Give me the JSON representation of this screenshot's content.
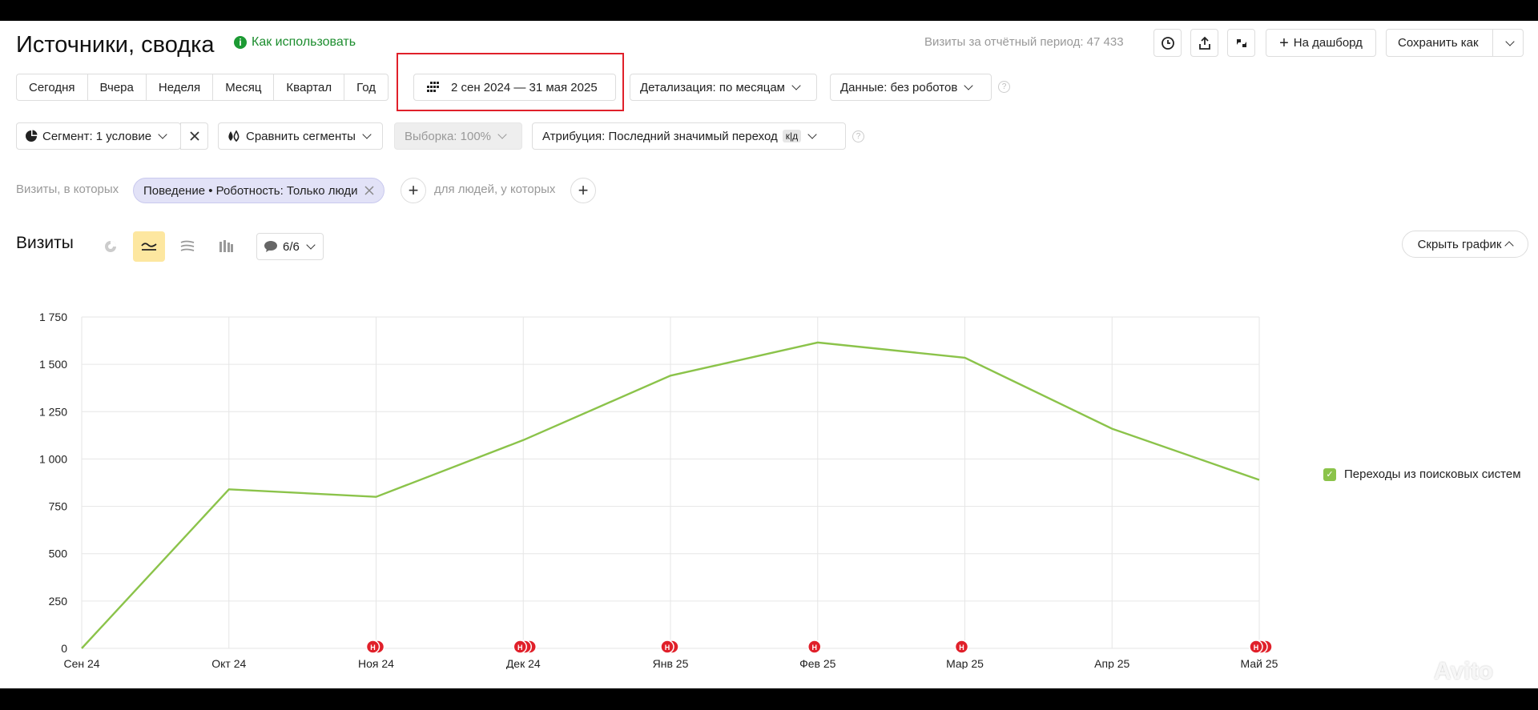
{
  "header": {
    "title": "Источники, сводка",
    "howto_label": "Как использовать",
    "visits_period": "Визиты за отчётный период: 47 433",
    "dashboard_label": "На дашборд",
    "save_as_label": "Сохранить как"
  },
  "period_buttons": [
    "Сегодня",
    "Вчера",
    "Неделя",
    "Месяц",
    "Квартал",
    "Год"
  ],
  "date_range": "2 сен 2024 — 31 мая 2025",
  "detail_label": "Детализация: по месяцам",
  "data_label": "Данные: без роботов",
  "segment_label": "Сегмент: 1 условие",
  "compare_label": "Сравнить сегменты",
  "sample_label": "Выборка: 100%",
  "attribution_label": "Атрибуция: Последний значимый переход",
  "attribution_badge": "к|д",
  "filters": {
    "visits_label": "Визиты, в которых",
    "chip_label": "Поведение • Роботность: Только люди",
    "people_label": "для людей, у которых"
  },
  "chart_section": {
    "title": "Визиты",
    "series_count": "6/6",
    "hide_label": "Скрыть график"
  },
  "legend_label": "Переходы из поисковых систем",
  "watermark": "Avito",
  "colors": {
    "line": "#8bc34a",
    "marker": "#e0202a",
    "highlight": "#e0202a"
  },
  "chart_data": {
    "type": "line",
    "categories": [
      "Сен 24",
      "Окт 24",
      "Ноя 24",
      "Дек 24",
      "Янв 25",
      "Фев 25",
      "Мар 25",
      "Апр 25",
      "Май 25"
    ],
    "series": [
      {
        "name": "Переходы из поисковых систем",
        "values": [
          0,
          840,
          800,
          1100,
          1440,
          1615,
          1535,
          1160,
          890
        ]
      }
    ],
    "yticks": [
      "0",
      "250",
      "500",
      "750",
      "1 000",
      "1 250",
      "1 500",
      "1 750"
    ],
    "ylim": [
      0,
      1750
    ],
    "grid": true,
    "legend": "right",
    "markers": [
      {
        "category_index": 2,
        "count": 2,
        "label": "H"
      },
      {
        "category_index": 3,
        "count": 3,
        "label": "H"
      },
      {
        "category_index": 4,
        "count": 2,
        "label": "H"
      },
      {
        "category_index": 5,
        "count": 1,
        "label": "H"
      },
      {
        "category_index": 6,
        "count": 1,
        "label": "H"
      },
      {
        "category_index": 8,
        "count": 3,
        "label": "H"
      }
    ]
  }
}
